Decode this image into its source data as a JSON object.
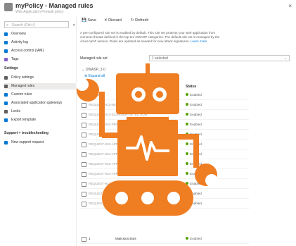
{
  "header": {
    "title": "myPolicy - Managed rules",
    "subtitle": "Web Application Firewall policy",
    "close": "×"
  },
  "sidebar": {
    "search_placeholder": "Search (Ctrl+/)",
    "items_top": [
      {
        "label": "Overview",
        "color": "#0078d4"
      },
      {
        "label": "Activity log",
        "color": "#0078d4"
      },
      {
        "label": "Access control (IAM)",
        "color": "#0078d4"
      },
      {
        "label": "Tags",
        "color": "#8661c5"
      }
    ],
    "section_settings": "Settings",
    "items_settings": [
      {
        "label": "Policy settings",
        "color": "#605e5c"
      },
      {
        "label": "Managed rules",
        "color": "#605e5c"
      },
      {
        "label": "Custom rules",
        "color": "#0078d4"
      },
      {
        "label": "Associated application gateways",
        "color": "#0078d4"
      },
      {
        "label": "Locks",
        "color": "#605e5c"
      },
      {
        "label": "Export template",
        "color": "#0078d4"
      }
    ],
    "section_support": "Support + troubleshooting",
    "items_support": [
      {
        "label": "New support request",
        "color": "#0078d4"
      }
    ]
  },
  "toolbar": {
    "save": "Save",
    "discard": "Discard",
    "refresh": "Refresh"
  },
  "description": "A pre-configured rule set is enabled by default. This rule set protects your web application from common threats defined in the top ten OWASP categories. The default rule set is managed by the Azure WAF service. Rules are updated as needed for new attack signatures.",
  "learn_more": "Learn more",
  "managed_ruleset_label": "Managed rule set",
  "managed_ruleset_value": "1 selected",
  "group_label": "OWASP_3.0",
  "expand_all": "Expand all",
  "columns": {
    "name": "Name",
    "status": "Status"
  },
  "rows": [
    {
      "name": "General",
      "status": "Enabled"
    },
    {
      "name": "REQUEST-911-METHOD-ENFORCEMENT",
      "status": "Enabled"
    },
    {
      "name": "REQUEST-913-SCANNER-DETECTION",
      "status": "Enabled"
    },
    {
      "name": "REQUEST-920-PROTOCOL-ENFORCEMENT",
      "status": "Enabled"
    },
    {
      "name": "REQUEST-921-PROTOCOL-ATTACK",
      "status": "Enabled"
    },
    {
      "name": "REQUEST-930-APPLICATION-ATTACK-LFI",
      "status": "Enabled"
    },
    {
      "name": "REQUEST-931-APPLICATION-ATTACK-RFI",
      "status": "Enabled"
    },
    {
      "name": "REQUEST-932-APPLICATION-ATTACK-RCE",
      "status": "Enabled"
    },
    {
      "name": "REQUEST-933-APPLICATION-ATTACK-PHP",
      "status": "Enabled"
    },
    {
      "name": "REQUEST-941-APPLICATION-ATTACK-XSS",
      "status": "Enabled"
    },
    {
      "name": "REQUEST-942-APPLICATION-ATTACK-SQLI",
      "status": "Enabled"
    },
    {
      "name": "REQUEST-943-APPLICATION-ATTACK-SESSION-FIXATION",
      "status": "Enabled"
    }
  ],
  "last_row": {
    "id": "1",
    "desc": "Malicious Bots",
    "status": "Enabled"
  },
  "colors": {
    "robot": "#ef7d22",
    "accent": "#0078d4",
    "enabled": "#57a300"
  }
}
